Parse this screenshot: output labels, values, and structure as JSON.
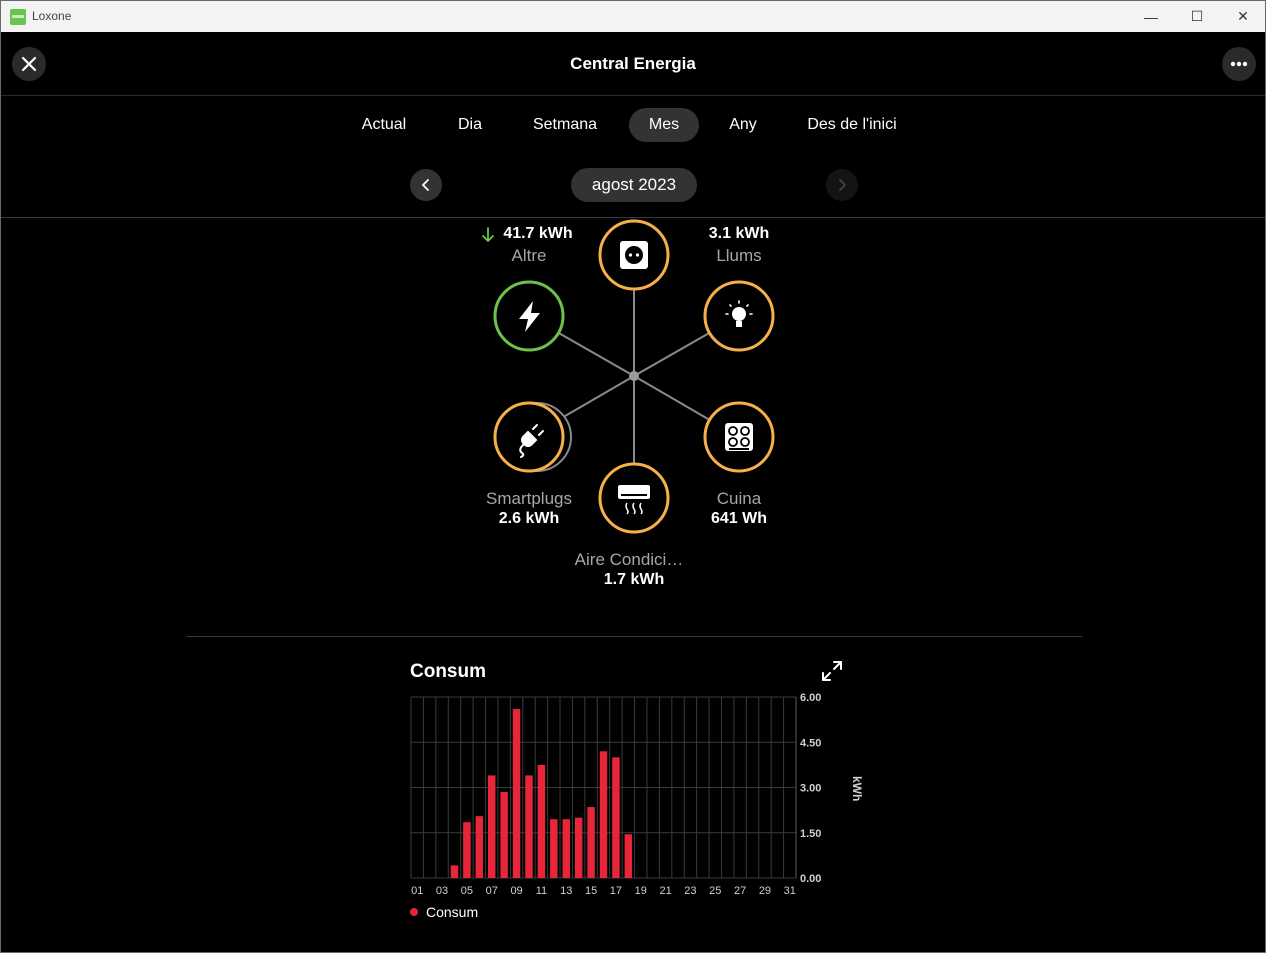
{
  "window": {
    "app_name": "Loxone",
    "controls": {
      "minimize": "—",
      "maximize": "☐",
      "close": "✕"
    }
  },
  "header": {
    "title": "Central Energia",
    "close_icon": "close-icon",
    "more_icon": "more-icon"
  },
  "tabs": [
    {
      "label": "Actual",
      "active": false
    },
    {
      "label": "Dia",
      "active": false
    },
    {
      "label": "Setmana",
      "active": false
    },
    {
      "label": "Mes",
      "active": true
    },
    {
      "label": "Any",
      "active": false
    },
    {
      "label": "Des de l'inici",
      "active": false
    }
  ],
  "date_nav": {
    "label": "agost 2023",
    "prev_icon": "chevron-left-icon",
    "next_icon": "chevron-right-icon"
  },
  "flow": {
    "center_icon": "power-socket-icon",
    "nodes": {
      "altre": {
        "label": "Altre",
        "value": "41.7  kWh",
        "arrow": "↓",
        "icon": "lightning-icon",
        "ring_color": "#6cc24a"
      },
      "llums": {
        "label": "Llums",
        "value": "3.1  kWh",
        "icon": "light-bulb-icon",
        "ring_color": "#f5b04a"
      },
      "smartplugs": {
        "label": "Smartplugs",
        "value": "2.6  kWh",
        "icon": "plug-icon",
        "ring_color": "#f5b04a"
      },
      "cuina": {
        "label": "Cuina",
        "value": "641  Wh",
        "icon": "cooktop-icon",
        "ring_color": "#f5b04a"
      },
      "aire": {
        "label": "Aire Condici…",
        "value": "1.7  kWh",
        "icon": "air-conditioner-icon",
        "ring_color": "#f5b04a"
      }
    }
  },
  "chart": {
    "title": "Consum",
    "expand_icon": "expand-icon",
    "legend": "Consum",
    "color": "#e8263a"
  },
  "chart_data": {
    "type": "bar",
    "title": "Consum",
    "ylabel": "kWh",
    "ylim": [
      0,
      6
    ],
    "yticks": [
      "0.00",
      "1.50",
      "3.00",
      "4.50",
      "6.00"
    ],
    "xticks": [
      "01",
      "03",
      "05",
      "07",
      "09",
      "11",
      "13",
      "15",
      "17",
      "19",
      "21",
      "23",
      "25",
      "27",
      "29",
      "31"
    ],
    "grid": true,
    "legend_position": "bottom-left",
    "categories": [
      "01",
      "02",
      "03",
      "04",
      "05",
      "06",
      "07",
      "08",
      "09",
      "10",
      "11",
      "12",
      "13",
      "14",
      "15",
      "16",
      "17",
      "18",
      "19",
      "20",
      "21",
      "22",
      "23",
      "24",
      "25",
      "26",
      "27",
      "28",
      "29",
      "30",
      "31"
    ],
    "series": [
      {
        "name": "Consum",
        "values": [
          0,
          0,
          0,
          0.42,
          1.85,
          2.05,
          3.4,
          2.85,
          5.6,
          3.4,
          3.75,
          1.95,
          1.95,
          2.0,
          2.35,
          4.2,
          4.0,
          1.45,
          0,
          0,
          0,
          0,
          0,
          0,
          0,
          0,
          0,
          0,
          0,
          0,
          0
        ]
      }
    ]
  }
}
